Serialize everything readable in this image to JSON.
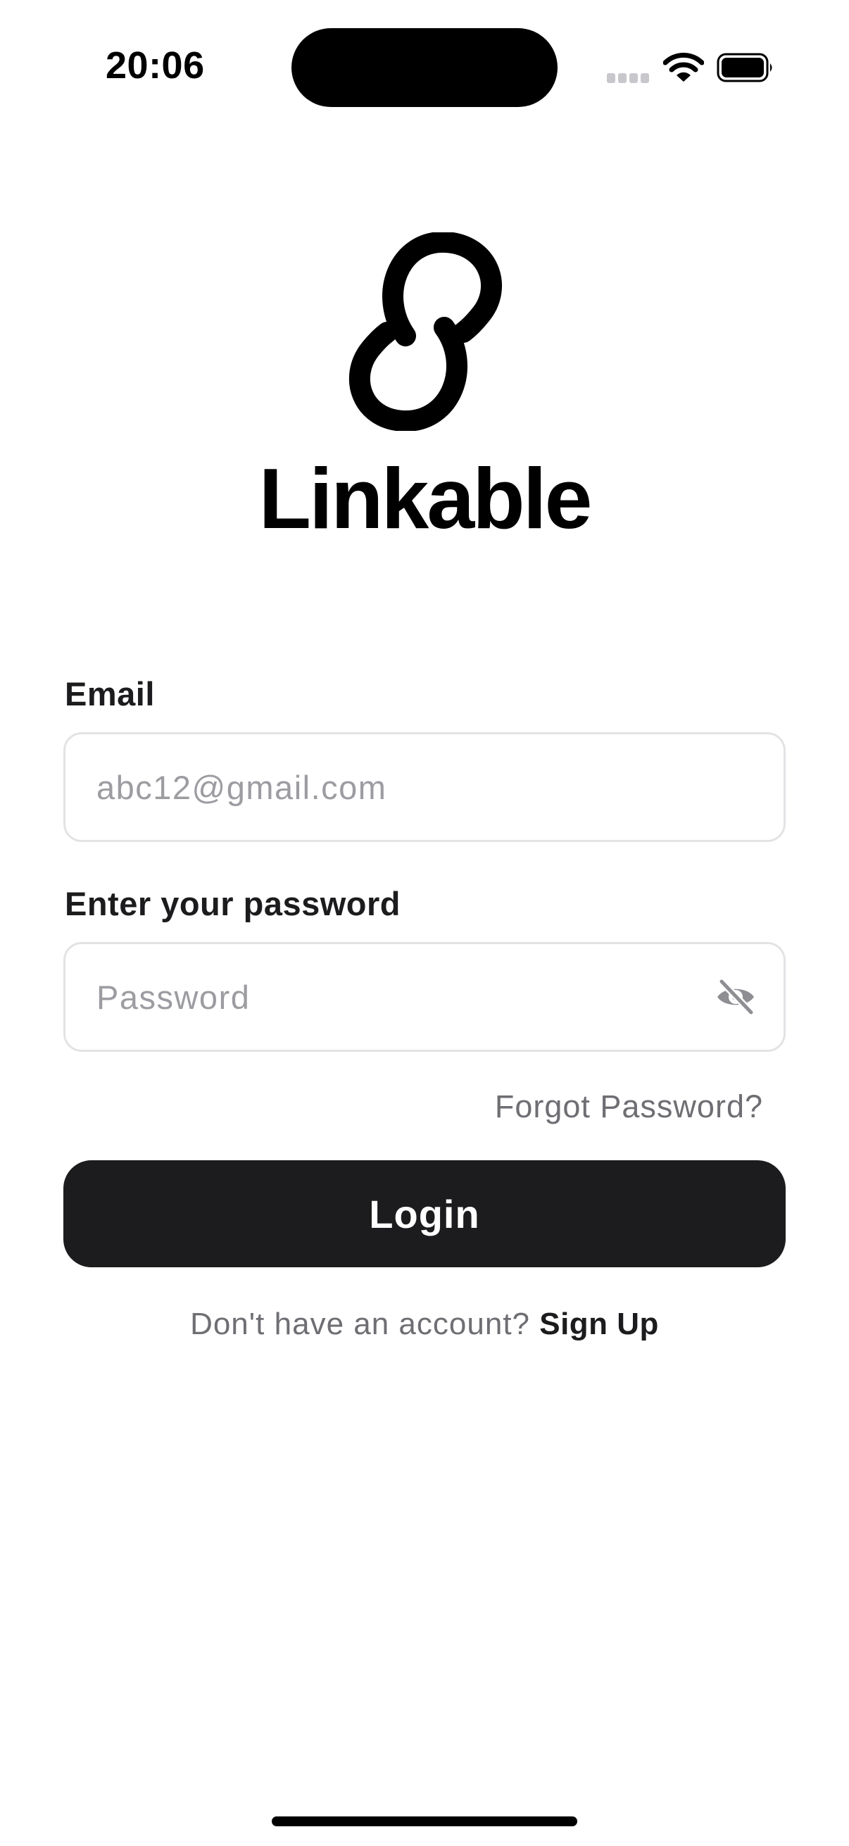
{
  "status_bar": {
    "time": "20:06",
    "icons": [
      "cellular-signal-icon",
      "wifi-icon",
      "battery-icon"
    ]
  },
  "brand": {
    "name": "Linkable",
    "logo_icon": "chain-link-icon",
    "color": "#000000"
  },
  "form": {
    "email": {
      "label": "Email",
      "value": "",
      "placeholder": "abc12@gmail.com"
    },
    "password": {
      "label": "Enter your password",
      "value": "",
      "placeholder": "Password",
      "toggle_icon": "eye-off-icon"
    },
    "forgot_password": "Forgot Password?",
    "login_label": "Login",
    "signup_prompt": "Don't have an account?",
    "signup_label": "Sign Up"
  },
  "colors": {
    "button_background": "#1c1c1e",
    "button_text": "#ffffff",
    "placeholder": "#9c9ca1",
    "muted_text": "#6e6e73",
    "input_border": "#e3e3e6"
  }
}
